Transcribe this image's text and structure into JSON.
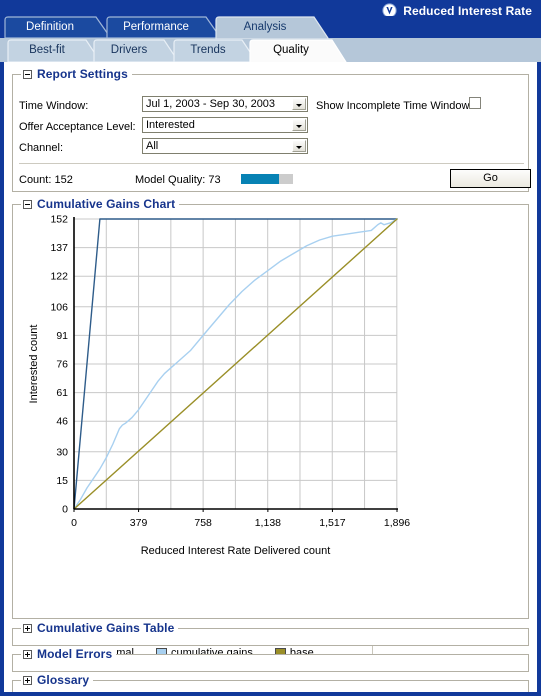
{
  "titlebar": {
    "icon": "shield-check-icon",
    "title": "Reduced Interest Rate"
  },
  "tabs_primary": [
    {
      "label": "Definition",
      "active": false
    },
    {
      "label": "Performance",
      "active": false
    },
    {
      "label": "Analysis",
      "active": true
    }
  ],
  "tabs_secondary": [
    {
      "label": "Best-fit",
      "active": false
    },
    {
      "label": "Drivers",
      "active": false
    },
    {
      "label": "Trends",
      "active": false
    },
    {
      "label": "Quality",
      "active": true
    }
  ],
  "report_settings": {
    "title": "Report Settings",
    "expanded": true,
    "time_window_label": "Time Window:",
    "time_window_value": "Jul 1, 2003 - Sep 30, 2003",
    "show_incomplete_label": "Show Incomplete Time Window:",
    "show_incomplete_checked": false,
    "offer_acceptance_label": "Offer Acceptance Level:",
    "offer_acceptance_value": "Interested",
    "channel_label": "Channel:",
    "channel_value": "All",
    "count_label": "Count: 152",
    "model_quality_label": "Model Quality: 73",
    "model_quality_percent": 73,
    "go_label": "Go"
  },
  "cumulative_gains_chart": {
    "title": "Cumulative Gains Chart",
    "expanded": true
  },
  "chart_data": {
    "type": "line",
    "title": "Cumulative Gains Chart",
    "xlabel": "Reduced Interest Rate Delivered count",
    "ylabel": "Interested count",
    "xlim": [
      0,
      1896
    ],
    "ylim": [
      0,
      152
    ],
    "xticks": [
      0,
      379,
      758,
      1138,
      1517,
      1896
    ],
    "xticklabels": [
      "0",
      "379",
      "758",
      "1,138",
      "1,517",
      "1,896"
    ],
    "yticks": [
      0,
      15,
      30,
      46,
      61,
      76,
      91,
      106,
      122,
      137,
      152
    ],
    "yticklabels": [
      "0",
      "15",
      "30",
      "46",
      "61",
      "76",
      "91",
      "106",
      "122",
      "137",
      "152"
    ],
    "grid": true,
    "legend_position": "bottom",
    "colors": {
      "maximal": "#2e5c8a",
      "cumulative_gains": "#a8d0f0",
      "base": "#9a8f28"
    },
    "series": [
      {
        "name": "maximal",
        "color": "#2e5c8a",
        "points": [
          [
            0,
            0
          ],
          [
            152,
            152
          ],
          [
            1896,
            152
          ]
        ]
      },
      {
        "name": "cumulative gains",
        "color": "#a8d0f0",
        "points": [
          [
            0,
            0
          ],
          [
            38,
            5
          ],
          [
            76,
            11
          ],
          [
            114,
            16
          ],
          [
            152,
            21
          ],
          [
            190,
            27
          ],
          [
            228,
            34
          ],
          [
            266,
            42
          ],
          [
            284,
            44
          ],
          [
            303,
            45
          ],
          [
            341,
            48
          ],
          [
            379,
            52
          ],
          [
            417,
            57
          ],
          [
            455,
            62
          ],
          [
            493,
            67
          ],
          [
            531,
            71
          ],
          [
            569,
            74
          ],
          [
            607,
            77
          ],
          [
            645,
            80
          ],
          [
            683,
            83
          ],
          [
            758,
            91
          ],
          [
            834,
            99
          ],
          [
            910,
            107
          ],
          [
            986,
            114
          ],
          [
            1062,
            120
          ],
          [
            1138,
            125
          ],
          [
            1214,
            130
          ],
          [
            1290,
            134
          ],
          [
            1366,
            138
          ],
          [
            1442,
            141
          ],
          [
            1517,
            143
          ],
          [
            1593,
            144
          ],
          [
            1669,
            145
          ],
          [
            1745,
            146
          ],
          [
            1783,
            149
          ],
          [
            1801,
            150
          ],
          [
            1820,
            149
          ],
          [
            1858,
            150
          ],
          [
            1896,
            152
          ]
        ]
      },
      {
        "name": "base",
        "color": "#9a8f28",
        "points": [
          [
            0,
            0
          ],
          [
            1896,
            152
          ]
        ]
      }
    ],
    "legend": [
      {
        "label": "maximal",
        "color": "#2e5c8a"
      },
      {
        "label": "cumulative gains",
        "color": "#a8d0f0"
      },
      {
        "label": "base",
        "color": "#9a8f28"
      }
    ]
  },
  "cumulative_gains_table": {
    "title": "Cumulative Gains Table",
    "expanded": false
  },
  "model_errors": {
    "title": "Model Errors",
    "expanded": false
  },
  "glossary": {
    "title": "Glossary",
    "expanded": false
  }
}
